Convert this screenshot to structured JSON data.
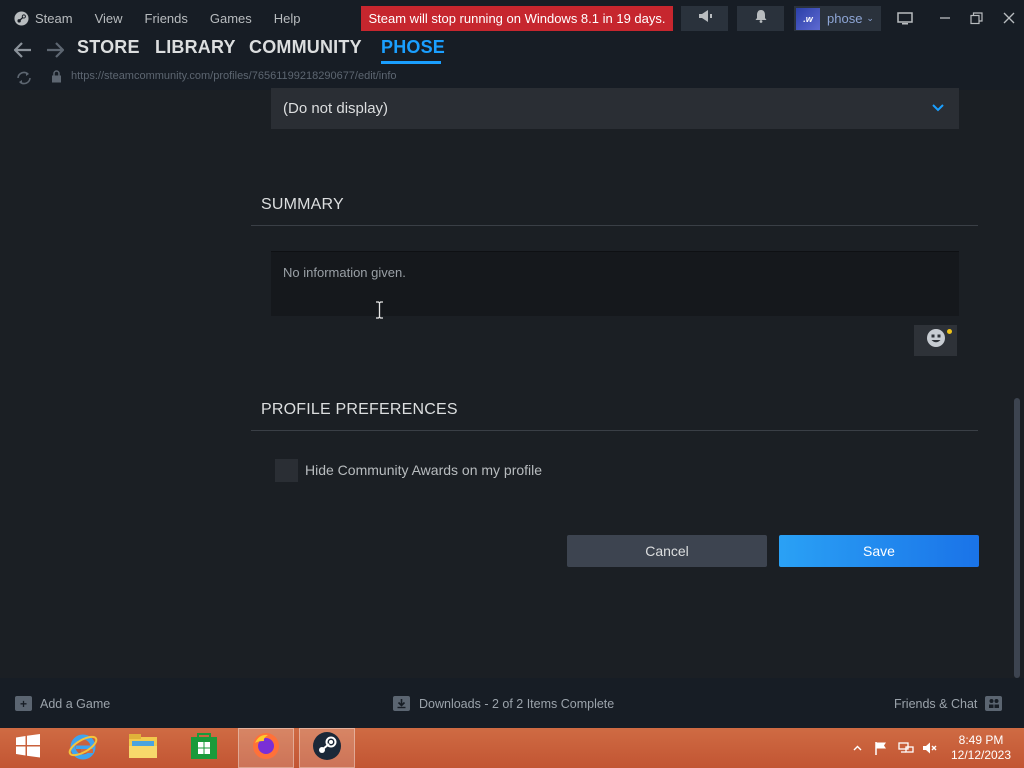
{
  "menubar": {
    "app_label": "Steam",
    "items": [
      "View",
      "Friends",
      "Games",
      "Help"
    ],
    "notice": "Steam will stop running on Windows 8.1 in 19 days.",
    "user": {
      "avatar_text": ".w",
      "name": "phose"
    }
  },
  "nav": {
    "tabs": [
      {
        "label": "STORE"
      },
      {
        "label": "LIBRARY"
      },
      {
        "label": "COMMUNITY"
      },
      {
        "label": "PHOSE"
      }
    ],
    "active_tab": "PHOSE"
  },
  "urlbar": {
    "url": "https://steamcommunity.com/profiles/76561199218290677/edit/info"
  },
  "form": {
    "select_value": "(Do not display)",
    "summary_title": "SUMMARY",
    "summary_text": "No information given.",
    "preferences_title": "PROFILE PREFERENCES",
    "hide_awards_label": "Hide Community Awards on my profile",
    "hide_awards_checked": false,
    "cancel_label": "Cancel",
    "save_label": "Save"
  },
  "statusbar": {
    "add_game": "Add a Game",
    "downloads": "Downloads - 2 of 2 Items Complete",
    "friends_chat": "Friends & Chat"
  },
  "taskbar": {
    "apps": [
      "start-icon",
      "internet-explorer-icon",
      "file-explorer-icon",
      "windows-store-icon",
      "firefox-icon",
      "steam-icon"
    ],
    "time": "8:49 PM",
    "date": "12/12/2023"
  },
  "colors": {
    "accent": "#1a9fff",
    "notice": "#c6262e",
    "save": "#1a73e8",
    "taskbar": "#c75e3a"
  }
}
